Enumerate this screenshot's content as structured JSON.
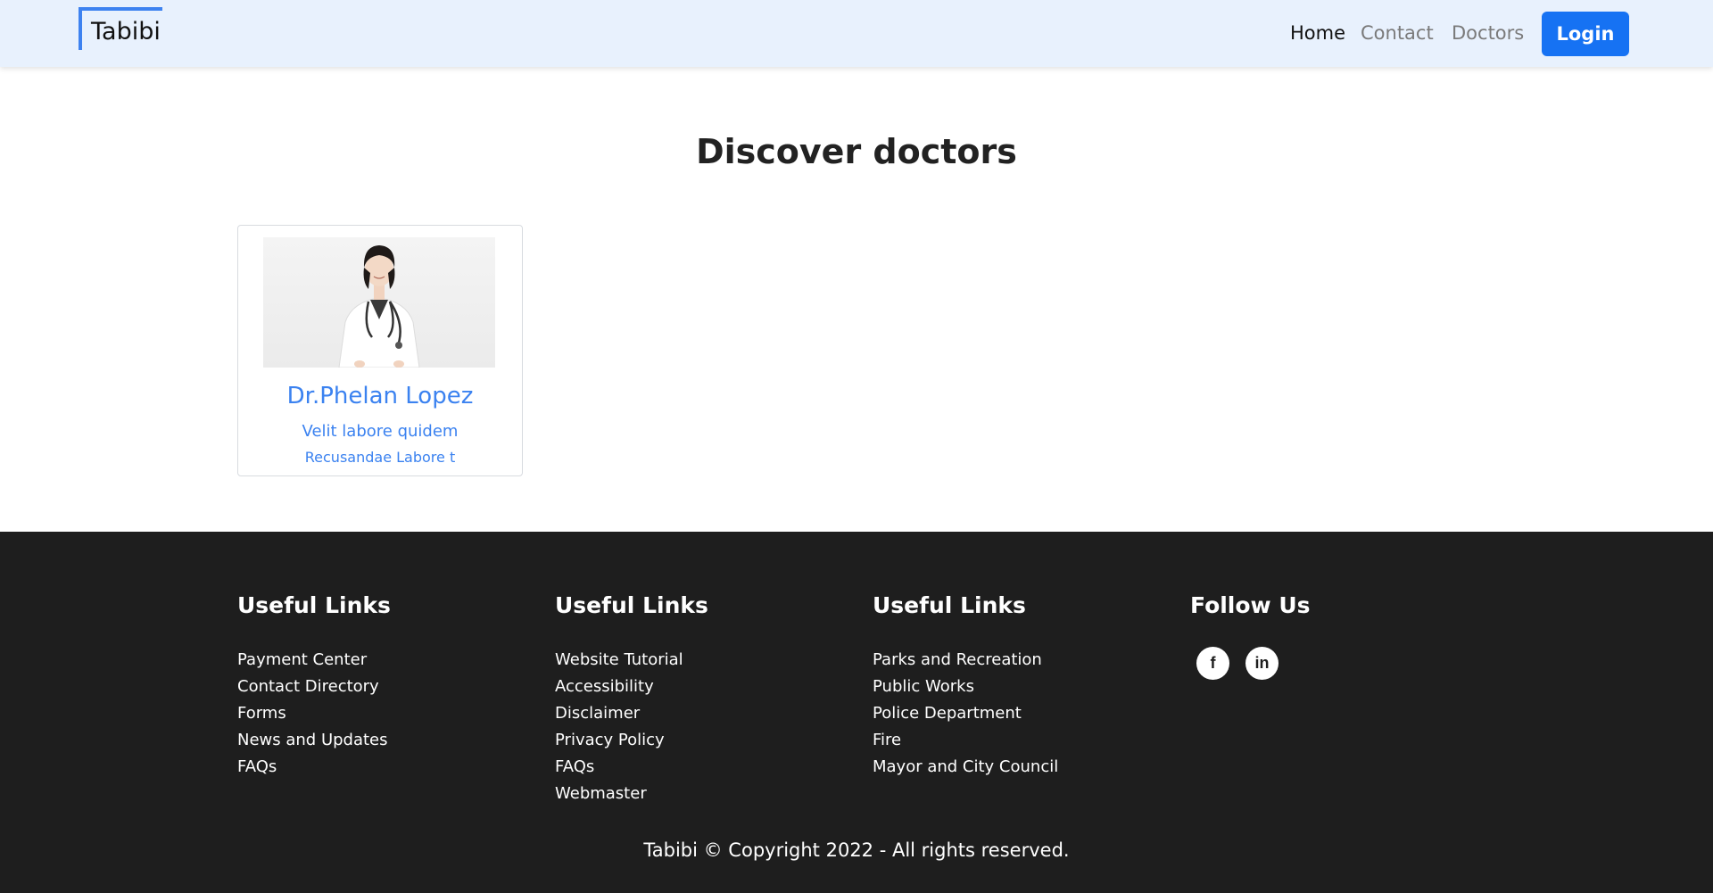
{
  "nav": {
    "brand": "Tabibi",
    "links": [
      {
        "label": "Home"
      },
      {
        "label": "Contact"
      },
      {
        "label": "Doctors"
      }
    ],
    "login_label": "Login"
  },
  "main": {
    "title": "Discover doctors",
    "doctors": [
      {
        "name": "Dr.Phelan Lopez",
        "specialty": "Velit labore quidem",
        "hospital": "Recusandae Labore t",
        "image_icon": "doctor-photo"
      }
    ]
  },
  "footer": {
    "columns": [
      {
        "heading": "Useful Links",
        "links": [
          "Payment Center",
          "Contact Directory",
          "Forms",
          "News and Updates",
          "FAQs"
        ]
      },
      {
        "heading": "Useful Links",
        "links": [
          "Website Tutorial",
          "Accessibility",
          "Disclaimer",
          "Privacy Policy",
          "FAQs",
          "Webmaster"
        ]
      },
      {
        "heading": "Useful Links",
        "links": [
          "Parks and Recreation",
          "Public Works",
          "Police Department",
          "Fire",
          "Mayor and City Council"
        ]
      }
    ],
    "follow": {
      "heading": "Follow Us",
      "icons": [
        {
          "name": "facebook-icon",
          "glyph": "f"
        },
        {
          "name": "linkedin-icon",
          "glyph": "in"
        }
      ]
    },
    "copyright": "Tabibi © Copyright 2022 - All rights reserved."
  },
  "colors": {
    "navbar_bg": "#e8f1fd",
    "accent": "#3b82f0",
    "login_bg": "#1672f3",
    "footer_bg": "#1e1e1e"
  }
}
